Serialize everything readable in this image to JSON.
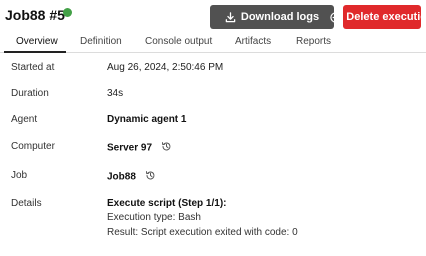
{
  "header": {
    "title": "Job88 #5",
    "status_color": "#43a047",
    "download_label": "Download logs",
    "delete_label": "Delete execution",
    "download_icon": "download-icon",
    "delete_icon": "minus-circle-icon"
  },
  "tabs": [
    {
      "label": "Overview",
      "active": true
    },
    {
      "label": "Definition",
      "active": false
    },
    {
      "label": "Console output",
      "active": false
    },
    {
      "label": "Artifacts",
      "active": false
    },
    {
      "label": "Reports",
      "active": false
    }
  ],
  "overview": {
    "started_at": {
      "label": "Started at",
      "value": "Aug 26, 2024, 2:50:46 PM"
    },
    "duration": {
      "label": "Duration",
      "value": "34s"
    },
    "agent": {
      "label": "Agent",
      "value": "Dynamic agent 1"
    },
    "computer": {
      "label": "Computer",
      "value": "Server 97",
      "icon": "history-icon"
    },
    "job": {
      "label": "Job",
      "value": "Job88",
      "icon": "history-icon"
    },
    "details": {
      "label": "Details",
      "heading": "Execute script (Step 1/1):",
      "lines": [
        "Execution type: Bash",
        "Result: Script execution exited with code: 0"
      ]
    }
  }
}
